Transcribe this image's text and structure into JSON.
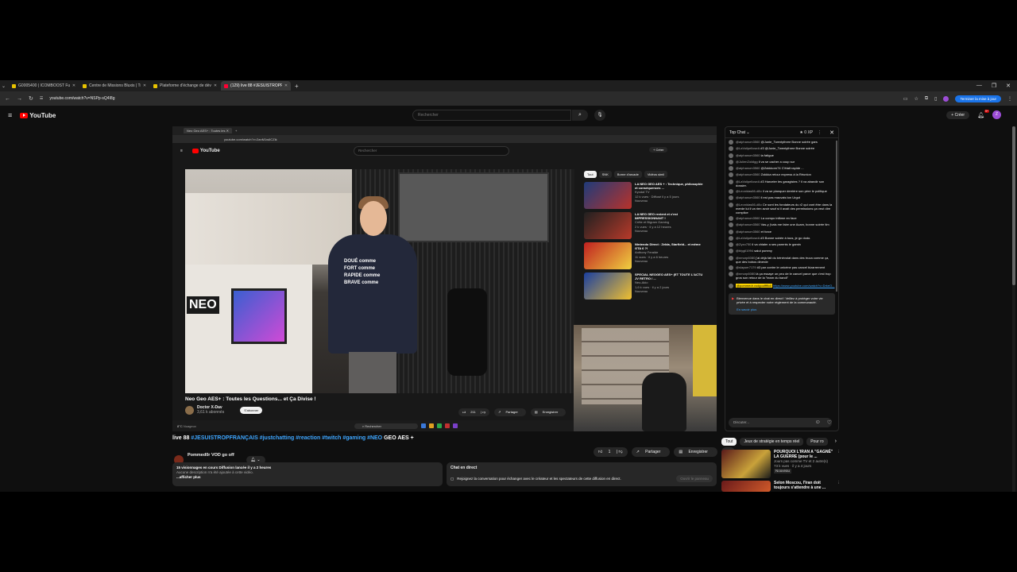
{
  "browser": {
    "tabs": [
      {
        "title": "G0005400 | ICOMBOOST Future"
      },
      {
        "title": "Centre de Missions Bluxis | Tr"
      },
      {
        "title": "Plateforme d'échange de dévi"
      },
      {
        "title": "(129) live 88 #JESUISTROPFRA"
      }
    ],
    "url": "youtube.com/watch?v=NSPp-sQ4I8g",
    "finish_update_label": "Terminer la mise à jour"
  },
  "yt": {
    "logo_text": "YouTube",
    "search_placeholder": "Rechercher",
    "create_label": "Créer",
    "notif_count": "9+",
    "avatar_letter": "Z"
  },
  "inner": {
    "tab_title": "Neo Geo AES+ : Toutes les",
    "url": "youtube.com/watch?v=2anM1w6CZik",
    "logo_text": "YouTube",
    "search_placeholder": "Rechercher",
    "create_label": "Créer",
    "video_title": "Neo Geo AES+ : Toutes les Questions... et Ça Divise !",
    "channel": "Doctor X-Dav",
    "channel_subs": "3,61 k abonnés",
    "subscribe": "S'abonner",
    "likes": "211",
    "share": "Partager",
    "save": "Enregistrer",
    "shirt_lines": [
      "DOUÉ comme",
      "FORT comme",
      "RAPIDE comme",
      "BRAVE comme"
    ],
    "arcade_text": "NEO",
    "taskbar_temp": "8°C",
    "taskbar_weather": "Nuageux",
    "taskbar_search": "Rechercher",
    "chips": [
      "Tout",
      "SNK",
      "Borne d'arcade",
      "Vidéos simil"
    ],
    "recs": [
      {
        "title": "LA NEO GEO AES + : Technique, philosophie et conséquences ...",
        "meta": "Kyodaï TV",
        "views": "12 k vues · Diffusé il y a 5 jours",
        "badge": "Nouveau"
      },
      {
        "title": "LA NEO GEO revient et c'est IMPRESSIONNANT !",
        "meta": "Crête et Bigram Gaming",
        "views": "2 k vues · il y a 12 heures",
        "badge": "Nouveau"
      },
      {
        "title": "Nintendo Direct : Zelda, Starfield... et même GTA 6 ?!",
        "meta": "Anthony Feralde",
        "views": "11 vues · il y a 6 heures",
        "badge": "Nouveau"
      },
      {
        "title": "SPECIAL NEOGEO AES+ (ET TOUTE L'ACTU JV RETRO / ...",
        "meta": "Neo-Akio",
        "views": "1,6 k vues · il y a 2 jours",
        "badge": "Nouveau"
      }
    ]
  },
  "video": {
    "title_plain": "live 88 ",
    "title_tags": "#JESUISTROPFRANÇAIS #justchatting #reaction #twitch #gaming #NEO",
    "title_end": " GEO AES +",
    "owner": "Pommed0r VOD go off",
    "owner_subs": "555 abonnés",
    "likes": "1",
    "share": "Partager",
    "save": "Enregistrer",
    "desc_line1": "15 visionnages en cours  Diffusion lancée il y a 2 heures",
    "desc_line2": "Aucune description n'a été ajoutée à cette vidéo.",
    "desc_more": "...afficher plus",
    "livechat_title": "Chat en direct",
    "livechat_text": "Rejoignez la conversation pour échanger avec le créateur et les spectateurs de cette diffusion en direct.",
    "livechat_btn": "Ouvrir le panneau"
  },
  "chat": {
    "header": "Top Chat",
    "xp": "0 XP",
    "messages": [
      {
        "user": "@alphanum3560",
        "text": "@Junie_Twentythree Bonne soirée gars"
      },
      {
        "user": "@LaVoilpelloseA",
        "text": "#3 @Junie_Twentythree Bonne soirée"
      },
      {
        "user": "@alphanum3560",
        "text": "la fatigue"
      },
      {
        "user": "@JulienZoldigg",
        "text": "il va se cacher a coup sur"
      },
      {
        "user": "@alphanum3560",
        "text": "@Zokkkorn74 C'était rapide ..."
      },
      {
        "user": "@alphanum3560",
        "text": "Zokkka retour express à la Réunion"
      },
      {
        "user": "@LaVoilpelloseA",
        "text": "#3 Harceler les garagistes ? il va abandir son dossier."
      },
      {
        "user": "@Leonidas66-d8o",
        "text": "il va se planquer derrière son père le politique"
      },
      {
        "user": "@alphanum3560",
        "text": "il est pas mauvais ton Urgot"
      },
      {
        "user": "@Leonidas66-d8o",
        "text": "Ce sont les fondateurs du r2 qui vont être dans la merde lui il va rien avoir sauf si il avait des permissions ça veut dire complice"
      },
      {
        "user": "@alphanum3560",
        "text": "La compo infâme en face"
      },
      {
        "user": "@alphanum3560",
        "text": "Vas-y j'vais me faire une Acam, bonne soirée tlm"
      },
      {
        "user": "@alphanum3560",
        "text": "et force"
      },
      {
        "user": "@LaVoilpelloseA",
        "text": "#3 Bonne soirée à tous, je go dodo."
      },
      {
        "user": "@Zyxo750",
        "text": "il va chialer a ses parents le gamin"
      },
      {
        "user": "@blygil1994",
        "text": "salut pommy"
      },
      {
        "user": "@nmorp6080",
        "text": "j'ai déjà fait du bénévolat dans des truca comme ça, que des bobos dinerde"
      },
      {
        "user": "@slayser7179",
        "text": "#3 par contre le unicène pas cancel bizarrement"
      },
      {
        "user": "@nmorp6080",
        "text": "là ça essaye un peu de le cancel parce que c'est trop gros son retour de la \"team du bandi\""
      }
    ],
    "highlight_user": "@pommedr.vodgoofffficil",
    "highlight_link": "https://www.youtube.com/watch?v=DrkeO...",
    "notice_text": "Bienvenue dans le chat en direct ! Veillez à protéger votre vie privée et à respecter notre règlement de la communauté.",
    "notice_more": "En savoir plus",
    "input_placeholder": "Discuter..."
  },
  "side": {
    "chips": [
      "Tout",
      "Jeux de stratégie en temps réel",
      "Pour ro"
    ],
    "recs": [
      {
        "title": "POURQUOI L'IRAN A \"GAGNÉ\" LA GUERRE (pour le ...",
        "channel": "Jours pas comme TV et 2 autre(s)",
        "views": "73 k vues · il y a 4 jours",
        "badge": "Nouveau"
      },
      {
        "title": "Selon Moscou, l'Iran doit toujours s'attendre à une ...",
        "channel": "",
        "views": "",
        "badge": ""
      }
    ]
  }
}
